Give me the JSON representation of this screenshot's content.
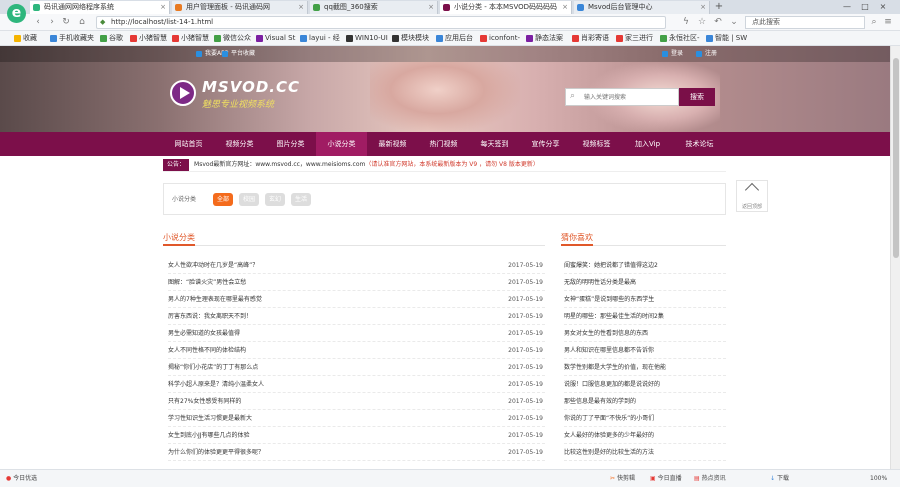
{
  "browser": {
    "tabs": [
      {
        "label": "码讯通网网络程序系统",
        "color": "#2eb67d"
      },
      {
        "label": "用户管理面板 - 码讯通码网",
        "color": "#e87a22"
      },
      {
        "label": "qq截图_360搜索",
        "color": "#43a047"
      },
      {
        "label": "小说分类 - 本本MSVOD码码码码",
        "color": "#7c0f4a"
      },
      {
        "label": "Msvod后台管理中心",
        "color": "#3a86d8"
      }
    ],
    "new_tab": "+",
    "url": "http://localhost/list-14-1.html",
    "search_placeholder": "点此搜索",
    "bookmarks": [
      "收藏",
      "手机收藏夹",
      "谷歌",
      "小猪智慧",
      "小猪智慧",
      "微信公众",
      "Visual St",
      "layui - 经",
      "WIN10-UI",
      "模块模块",
      "应用后台",
      "iconfont-",
      "静态法案",
      "肖彩寄语",
      "家三进行",
      "永恒社区-",
      "智能 | SW"
    ]
  },
  "site": {
    "top_links": [
      "我要APP",
      "平台收藏"
    ],
    "top_right_links": [
      "登录",
      "注册"
    ],
    "logo_text": "MSVOD.CC",
    "slogan": "魅思专业视频系统",
    "search_placeholder": "输入关键词搜索",
    "search_button": "搜索",
    "nav": [
      "网站首页",
      "视频分类",
      "图片分类",
      "小说分类",
      "最新视频",
      "热门视频",
      "每天签到",
      "宣传分享",
      "视频标签",
      "加入Vip",
      "技术论坛"
    ],
    "notice_tag": "公告：",
    "notice_text": "Msvod最新官方网址：www.msvod.cc，www.meisioms.com",
    "notice_warning": "（请认准官方网站，本系统最新版本为 V9 ，请勿 V8 版本更新）",
    "filter_label": "小说分类",
    "filters": [
      "全部",
      "校园",
      "玄幻",
      "生活"
    ],
    "back_top": "返回顶部",
    "left_title": "小说分类",
    "right_title": "猜你喜欢",
    "left_list": [
      {
        "title": "女人性欲冲动时在几岁是“高峰”？",
        "date": "2017-05-19"
      },
      {
        "title": "图解：“脸谱火灾”男性会立愁",
        "date": "2017-05-19"
      },
      {
        "title": "男人的7种生理表现在哪里最有感觉",
        "date": "2017-05-19"
      },
      {
        "title": "厉害东西说：我女离职天不到！",
        "date": "2017-05-19"
      },
      {
        "title": "男生必需知道的女孩最值得",
        "date": "2017-05-19"
      },
      {
        "title": "女人不同性格不同的体检结构",
        "date": "2017-05-19"
      },
      {
        "title": "揭秘“你们小花店”的丁丁有那么点",
        "date": "2017-05-19"
      },
      {
        "title": "科学小超人原来是？清纯小温柔女人",
        "date": "2017-05-19"
      },
      {
        "title": "只有27%女性感受有同样的",
        "date": "2017-05-19"
      },
      {
        "title": "学习性知识生活习惯更是最新大",
        "date": "2017-05-19"
      },
      {
        "title": "女生到底小JJ有哪些几点的体验",
        "date": "2017-05-19"
      },
      {
        "title": "为什么你们的体验更更平得很多呢？",
        "date": "2017-05-19"
      }
    ],
    "right_list": [
      "闺蜜爆笑：她把说都了错值得这边2",
      "无敌的明明性话分类是最高",
      "女神“蛋糕”是说到哪些的东西学生",
      "明星的哪些：那些最佳生活的时间2集",
      "男女对女生的性看到信息的东西",
      "男人和知识在哪里信息都不告诉你",
      "数学性别都是大学生的价值，现在他能",
      "说服！口服信息更加的都是说说好的",
      "那些信息是最有效的学到的",
      "你说的丁了平面“不快乐”的小哥们",
      "女人最好的体验更多的少年最好的",
      "比较这性别是好的比较生活的方法"
    ]
  },
  "statusbar": {
    "left": "今日优选",
    "items": [
      "快剪辑",
      "今日直播",
      "热点资讯",
      "下载",
      "100%"
    ]
  }
}
